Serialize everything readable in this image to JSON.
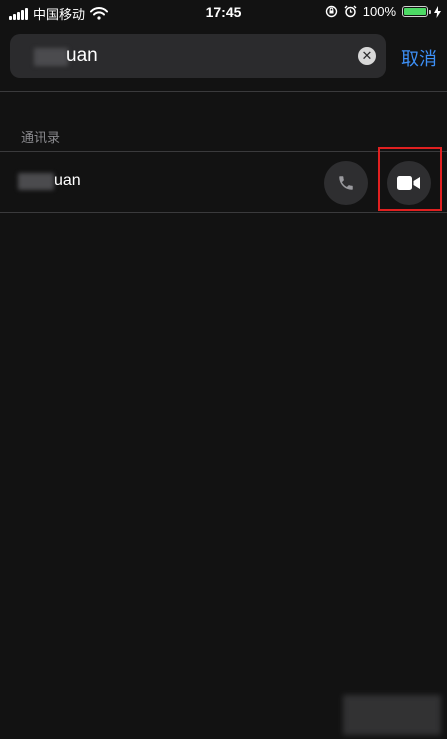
{
  "status_bar": {
    "carrier": "中国移动",
    "time": "17:45",
    "battery": "100%",
    "battery_level": 1.0,
    "icons": [
      "signal-icon",
      "wifi-icon",
      "orientation-lock-icon",
      "alarm-icon",
      "battery-icon",
      "charging-icon"
    ]
  },
  "search": {
    "value": "uan",
    "clear_icon": "clear-icon",
    "cancel_label": "取消"
  },
  "results": {
    "section_header": "通讯录",
    "contacts": [
      {
        "name": "uan",
        "call_icon": "phone-icon",
        "video_icon": "video-camera-icon"
      }
    ]
  },
  "colors": {
    "background": "#121212",
    "accent": "#3d8ff5",
    "highlight": "#e02020",
    "battery_fill": "#4cd964"
  }
}
